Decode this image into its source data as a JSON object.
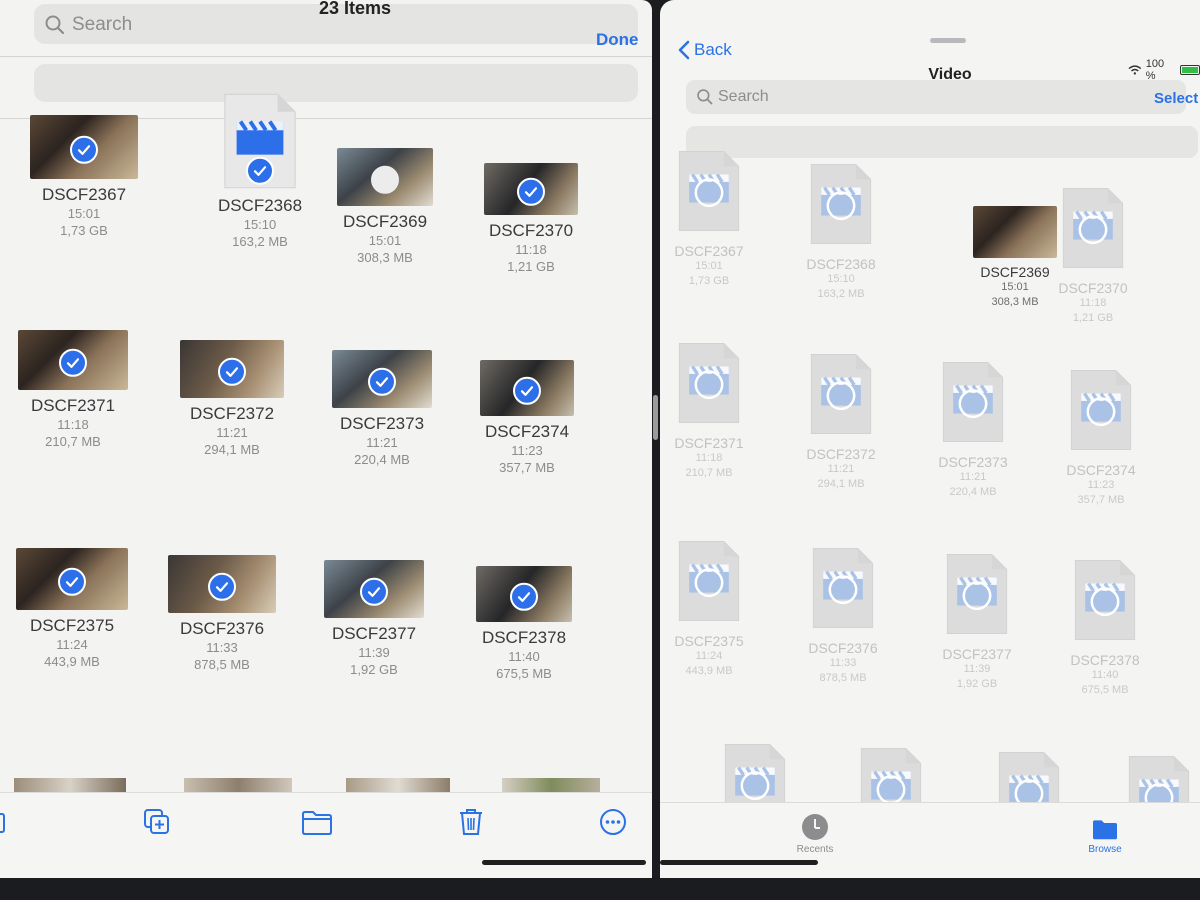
{
  "left": {
    "title": "23 Items",
    "search_placeholder": "Search",
    "done_label": "Done",
    "items": [
      {
        "name": "DSCF2367",
        "time": "15:01",
        "size": "1,73 GB",
        "kind": "photo",
        "checked": true
      },
      {
        "name": "DSCF2368",
        "time": "15:10",
        "size": "163,2 MB",
        "kind": "file",
        "checked": true
      },
      {
        "name": "DSCF2369",
        "time": "15:01",
        "size": "308,3 MB",
        "kind": "photo",
        "checked": false
      },
      {
        "name": "DSCF2370",
        "time": "11:18",
        "size": "1,21 GB",
        "kind": "photo",
        "checked": true
      },
      {
        "name": "DSCF2371",
        "time": "11:18",
        "size": "210,7 MB",
        "kind": "photo",
        "checked": true
      },
      {
        "name": "DSCF2372",
        "time": "11:21",
        "size": "294,1 MB",
        "kind": "photo",
        "checked": true
      },
      {
        "name": "DSCF2373",
        "time": "11:21",
        "size": "220,4 MB",
        "kind": "photo",
        "checked": true
      },
      {
        "name": "DSCF2374",
        "time": "11:23",
        "size": "357,7 MB",
        "kind": "photo",
        "checked": true
      },
      {
        "name": "DSCF2375",
        "time": "11:24",
        "size": "443,9 MB",
        "kind": "photo",
        "checked": true
      },
      {
        "name": "DSCF2376",
        "time": "11:33",
        "size": "878,5 MB",
        "kind": "photo",
        "checked": true
      },
      {
        "name": "DSCF2377",
        "time": "11:39",
        "size": "1,92 GB",
        "kind": "photo",
        "checked": true
      },
      {
        "name": "DSCF2378",
        "time": "11:40",
        "size": "675,5 MB",
        "kind": "photo",
        "checked": true
      }
    ],
    "toolbar": [
      "duplicate-icon",
      "folder-icon",
      "trash-icon",
      "more-icon"
    ]
  },
  "right": {
    "back_label": "Back",
    "title": "Video",
    "battery": "100 %",
    "search_placeholder": "Search",
    "select_label": "Select",
    "items": [
      {
        "name": "DSCF2367",
        "time": "15:01",
        "size": "1,73 GB",
        "kind": "file"
      },
      {
        "name": "DSCF2368",
        "time": "15:10",
        "size": "163,2 MB",
        "kind": "file"
      },
      {
        "name": "DSCF2369",
        "time": "15:01",
        "size": "308,3 MB",
        "kind": "photo"
      },
      {
        "name": "DSCF2370",
        "time": "11:18",
        "size": "1,21 GB",
        "kind": "file"
      },
      {
        "name": "DSCF2371",
        "time": "11:18",
        "size": "210,7 MB",
        "kind": "file"
      },
      {
        "name": "DSCF2372",
        "time": "11:21",
        "size": "294,1 MB",
        "kind": "file"
      },
      {
        "name": "DSCF2373",
        "time": "11:21",
        "size": "220,4 MB",
        "kind": "file"
      },
      {
        "name": "DSCF2374",
        "time": "11:23",
        "size": "357,7 MB",
        "kind": "file"
      },
      {
        "name": "DSCF2375",
        "time": "11:24",
        "size": "443,9 MB",
        "kind": "file"
      },
      {
        "name": "DSCF2376",
        "time": "11:33",
        "size": "878,5 MB",
        "kind": "file"
      },
      {
        "name": "DSCF2377",
        "time": "11:39",
        "size": "1,92 GB",
        "kind": "file"
      },
      {
        "name": "DSCF2378",
        "time": "11:40",
        "size": "675,5 MB",
        "kind": "file"
      }
    ],
    "tabs": [
      {
        "label": "Recents",
        "icon": "clock-icon",
        "active": false
      },
      {
        "label": "Browse",
        "icon": "folder-icon",
        "active": true
      }
    ]
  },
  "colors": {
    "accent": "#2a72e6",
    "check": "#2d6fe8"
  }
}
